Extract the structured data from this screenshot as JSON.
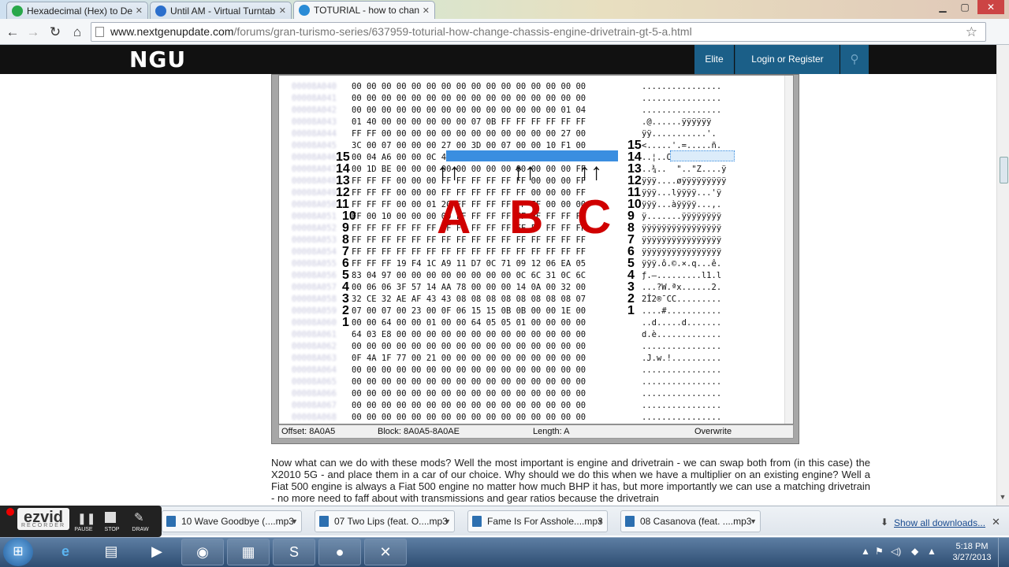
{
  "browser": {
    "tabs": [
      {
        "title": "Hexadecimal (Hex) to Dec",
        "fav": "#29a84a"
      },
      {
        "title": "Until AM - Virtual Turntab",
        "fav": "#2c6fcc"
      },
      {
        "title": "TOTURIAL - how to chang",
        "fav": "#2a8bd6"
      }
    ],
    "url_host": "www.nextgenupdate.com",
    "url_path": "/forums/gran-turismo-series/637959-toturial-how-change-chassis-engine-drivetrain-gt-5-a.html",
    "window_buttons": [
      "▁",
      "▢",
      "✕"
    ]
  },
  "site": {
    "logo": "NGU",
    "elite": "Elite",
    "login": "Login or Register"
  },
  "hex": {
    "rows": [
      {
        "hex": "00 00 00 00 00 00 00 00 00 00 00 00 00 00 00 00",
        "ascii": "................"
      },
      {
        "hex": "00 00 00 00 00 00 00 00 00 00 00 00 00 00 00 00",
        "ascii": "................"
      },
      {
        "hex": "00 00 00 00 00 00 00 00 00 00 00 00 00 00 01 04",
        "ascii": "................"
      },
      {
        "hex": "01 40 00 00 00 00 00 00 07 0B FF FF FF FF FF FF",
        "ascii": ".@......ÿÿÿÿÿÿ"
      },
      {
        "hex": "FF FF 00 00 00 00 00 00 00 00 00 00 00 00 27 00",
        "ascii": "ÿÿ...........'."
      },
      {
        "hex": "3C 00 07 00 00 00 27 00 3D 00 07 00 00 10 F1 00",
        "ascii": "<.....'.=.....ñ."
      },
      {
        "hex": "00 04 A6 00 00 0C 4F 00 00 0B D2 00 00 0D 5A 00",
        "ascii": "..¦..O...Ò...Z."
      },
      {
        "hex": "00 1D BE 00 00 00 00 00 00 00 00 00 00 00 00 FF",
        "ascii": "..¾..  \"..\"Z....ÿ"
      },
      {
        "hex": "FF FF FF 00 00 00 FF FF FF FF FF FF 00 00 00 FF",
        "ascii": "ÿÿÿ....øÿÿÿÿÿÿÿÿÿ"
      },
      {
        "hex": "FF FF FF 00 00 00 FF FF FF FF FF FF 00 00 00 FF",
        "ascii": "ÿÿÿ...lÿÿÿÿ...'ÿ"
      },
      {
        "hex": "FF FF FF 00 00 01 20 FF FF FF FF FF FF 00 00 00",
        "ascii": "ÿÿÿ...àÿÿÿÿ...,."
      },
      {
        "hex": "FF 00 10 00 00 00 00 FF FF FF FF FF FF FF FF FF",
        "ascii": "ÿ.......ÿÿÿÿÿÿÿÿ"
      },
      {
        "hex": "FF FF FF FF FF FF FF FF FF FF FF FF FF FF FF FF",
        "ascii": "ÿÿÿÿÿÿÿÿÿÿÿÿÿÿÿÿ"
      },
      {
        "hex": "FF FF FF FF FF FF FF FF FF FF FF FF FF FF FF FF",
        "ascii": "ÿÿÿÿÿÿÿÿÿÿÿÿÿÿÿÿ"
      },
      {
        "hex": "FF FF FF FF FF FF FF FF FF FF FF FF FF FF FF FF",
        "ascii": "ÿÿÿÿÿÿÿÿÿÿÿÿÿÿÿÿ"
      },
      {
        "hex": "FF FF FF 19 F4 1C A9 11 D7 0C 71 09 12 06 EA 05",
        "ascii": "ÿÿÿ.ô.©.×.q...ê."
      },
      {
        "hex": "83 04 97 00 00 00 00 00 00 00 00 0C 6C 31 0C 6C",
        "ascii": "ƒ.—.........l1.l"
      },
      {
        "hex": "00 06 06 3F 57 14 AA 78 00 00 00 14 0A 00 32 00",
        "ascii": "...?W.ªx......2."
      },
      {
        "hex": "32 CE 32 AE AF 43 43 08 08 08 08 08 08 08 08 07",
        "ascii": "2Î2®¯CC........."
      },
      {
        "hex": "07 00 07 00 23 00 0F 06 15 15 0B 0B 00 00 1E 00",
        "ascii": "....#..........."
      },
      {
        "hex": "00 00 64 00 00 01 00 00 64 05 05 01 00 00 00 00",
        "ascii": "..d.....d......."
      },
      {
        "hex": "64 03 E8 00 00 00 00 00 00 00 00 00 00 00 00 00",
        "ascii": "d.è............."
      },
      {
        "hex": "00 00 00 00 00 00 00 00 00 00 00 00 00 00 00 00",
        "ascii": "................"
      },
      {
        "hex": "0F 4A 1F 77 00 21 00 00 00 00 00 00 00 00 00 00",
        "ascii": ".J.w.!.........."
      },
      {
        "hex": "00 00 00 00 00 00 00 00 00 00 00 00 00 00 00 00",
        "ascii": "................"
      },
      {
        "hex": "00 00 00 00 00 00 00 00 00 00 00 00 00 00 00 00",
        "ascii": "................"
      },
      {
        "hex": "00 00 00 00 00 00 00 00 00 00 00 00 00 00 00 00",
        "ascii": "................"
      },
      {
        "hex": "00 00 00 00 00 00 00 00 00 00 00 00 00 00 00 00",
        "ascii": "................"
      },
      {
        "hex": "00 00 00 00 00 00 00 00 00 00 00 00 00 00 00 00",
        "ascii": "................"
      }
    ],
    "left_numbers": [
      "15",
      "14",
      "13",
      "12",
      "11",
      "10",
      "9",
      "8",
      "7",
      "6",
      "5",
      "4",
      "3",
      "2",
      "1"
    ],
    "right_numbers": [
      "15",
      "14",
      "13",
      "12",
      "11",
      "10",
      "9",
      "8",
      "7",
      "6",
      "5",
      "4",
      "3",
      "2",
      "1"
    ],
    "letters": [
      "A",
      "B",
      "C"
    ],
    "status": {
      "offset": "Offset: 8A0A5",
      "block": "Block: 8A0A5-8A0AE",
      "length": "Length: A",
      "mode": "Overwrite"
    }
  },
  "article": {
    "text": "Now what can we do with these mods? Well the most important is engine and drivetrain - we can swap both from (in this case) the X2010 5G - and place them in a car of our choice. Why should we do this when we have a multiplier on an existing engine? Well a Fiat 500 engine is always a Fiat 500 engine no matter how much BHP it has, but more importantly we can use a matching drivetrain - no more need to faff about with transmissions and gear ratios because the drivetrain"
  },
  "downloads": {
    "items": [
      "10 Wave Goodbye (....mp3",
      "07 Two Lips (feat. O....mp3",
      "Fame Is For Asshole....mp3",
      "08 Casanova (feat. ....mp3"
    ],
    "show_all": "Show all downloads..."
  },
  "ezvid": {
    "logo": "ezvid",
    "recorder": "RECORDER",
    "buttons": [
      "PAUSE",
      "STOP",
      "DRAW"
    ]
  },
  "taskbar": {
    "time": "5:18 PM",
    "date": "3/27/2013"
  }
}
